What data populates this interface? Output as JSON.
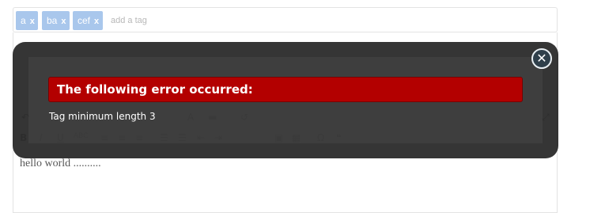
{
  "tags": {
    "items": [
      {
        "label": "a",
        "remove": "x"
      },
      {
        "label": "ba",
        "remove": "x"
      },
      {
        "label": "cef",
        "remove": "x"
      }
    ],
    "placeholder": "add a tag"
  },
  "editor": {
    "content": "hello world ..........",
    "toolbar_icons": [
      "bold-icon",
      "italic-icon",
      "underline-icon",
      "strikethrough-icon",
      "align-left-icon",
      "align-center-icon",
      "align-right-icon",
      "ordered-list-icon",
      "unordered-list-icon",
      "outdent-icon",
      "indent-icon",
      "font-color-icon",
      "highlight-icon",
      "undo-icon",
      "image-icon",
      "table-icon",
      "superscript-icon",
      "quote-icon"
    ]
  },
  "error_dialog": {
    "title": "The following error occurred:",
    "message": "Tag minimum length 3",
    "close_label": "✕"
  },
  "colors": {
    "tag_bg": "#a9c7ec",
    "error_bg": "#b30000",
    "overlay_bg": "#262626"
  }
}
